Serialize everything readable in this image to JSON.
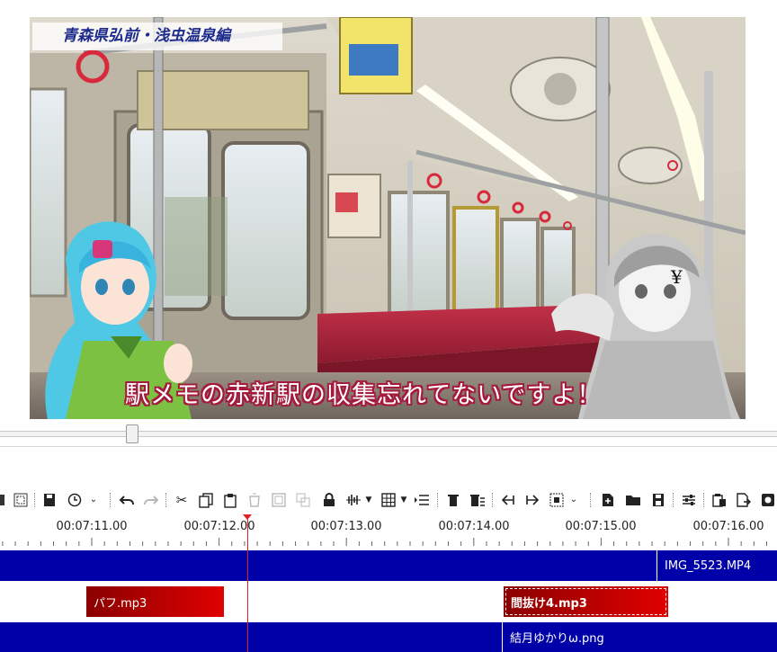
{
  "preview": {
    "location_caption": "青森県弘前・浅虫温泉編",
    "subtitle": "駅メモの赤新駅の収集忘れてないですよ！",
    "character_mark": "¥"
  },
  "toolbar": {
    "icons": [
      "select-all-icon",
      "grid-icon",
      "save-icon",
      "clock-icon",
      "undo-icon",
      "redo-icon",
      "cut-icon",
      "copy-icon",
      "paste-icon",
      "cup-icon",
      "frame-icon",
      "multi-icon",
      "lock-icon",
      "waveform-icon",
      "table-icon",
      "indent-icon",
      "delete-icon",
      "delete-list-icon",
      "jump-start-icon",
      "jump-end-icon",
      "fit-icon",
      "add-file-icon",
      "folder-icon",
      "disk-icon",
      "settings-sliders-icon",
      "clipboard-icon",
      "export-icon",
      "render-icon"
    ]
  },
  "timeline": {
    "ruler_labels": [
      "00:07:11.00",
      "00:07:12.00",
      "00:07:13.00",
      "00:07:14.00",
      "00:07:15.00",
      "00:07:16.00"
    ],
    "clips": {
      "video": {
        "label": "IMG_5523.MP4"
      },
      "audio_1": {
        "label": "パフ.mp3"
      },
      "audio_2": {
        "label": "間抜け4.mp3"
      },
      "image": {
        "label": "結月ゆかりω.png"
      }
    },
    "colors": {
      "video": "#0000a8",
      "audio": "#d00000",
      "playhead": "#e02020"
    }
  }
}
